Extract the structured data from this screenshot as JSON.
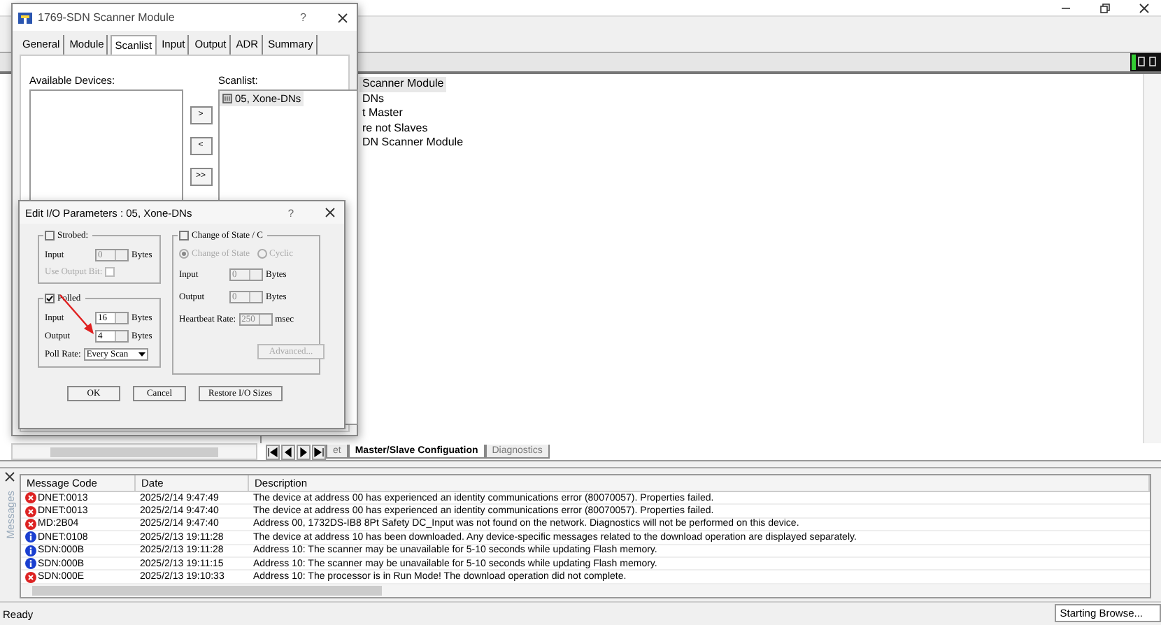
{
  "main_window": {
    "tree_items": [
      {
        "label": "Scanner Module",
        "selected": true
      },
      {
        "label": "DNs",
        "selected": false
      },
      {
        "label": "t Master",
        "selected": false
      },
      {
        "label": "re not Slaves",
        "selected": false
      },
      {
        "label": "DN Scanner Module",
        "selected": false
      }
    ],
    "sheet_tabs": [
      {
        "label": "et",
        "selected": false
      },
      {
        "label": "Master/Slave Configuation",
        "selected": true
      },
      {
        "label": "Diagnostics",
        "selected": false
      }
    ]
  },
  "scanner_dialog": {
    "title": "1769-SDN Scanner Module",
    "help": "?",
    "tabs": [
      {
        "label": "General",
        "selected": false
      },
      {
        "label": "Module",
        "selected": false
      },
      {
        "label": "Scanlist",
        "selected": true
      },
      {
        "label": "Input",
        "selected": false
      },
      {
        "label": "Output",
        "selected": false
      },
      {
        "label": "ADR",
        "selected": false
      },
      {
        "label": "Summary",
        "selected": false
      }
    ],
    "available_label": "Available Devices:",
    "move_buttons": [
      ">",
      "<",
      ">>"
    ],
    "scanlist_label": "Scanlist:",
    "scanlist": [
      {
        "label": "05, Xone-DNs",
        "selected": true
      }
    ]
  },
  "io_dialog": {
    "title": "Edit I/O Parameters : 05, Xone-DNs",
    "help": "?",
    "strobed": {
      "title": "Strobed:",
      "checked": false,
      "fields": [
        {
          "label": "Input",
          "value": "0",
          "unit": "Bytes",
          "disabled": true
        }
      ],
      "use_output_bit": {
        "label": "Use Output Bit:",
        "checked": false
      }
    },
    "polled": {
      "title": "Polled",
      "checked": true,
      "fields": [
        {
          "label": "Input",
          "value": "16",
          "unit": "Bytes",
          "disabled": false
        },
        {
          "label": "Output",
          "value": "4",
          "unit": "Bytes",
          "disabled": false
        }
      ],
      "poll_rate": {
        "label": "Poll Rate:",
        "value": "Every Scan"
      }
    },
    "change_of_state": {
      "title": "Change of State / C",
      "checked": false,
      "modes": [
        {
          "label": "Change of State",
          "selected": true
        },
        {
          "label": "Cyclic",
          "selected": false
        }
      ],
      "fields": [
        {
          "label": "Input",
          "value": "0",
          "unit": "Bytes",
          "disabled": true
        },
        {
          "label": "Output",
          "value": "0",
          "unit": "Bytes",
          "disabled": true
        },
        {
          "label": "Heartbeat Rate:",
          "value": "250",
          "unit": "msec",
          "disabled": true
        }
      ],
      "advanced": "Advanced..."
    },
    "buttons": [
      "OK",
      "Cancel",
      "Restore I/O Sizes"
    ]
  },
  "messages": {
    "panel_label": "Messages",
    "columns": [
      "Message Code",
      "Date",
      "Description"
    ],
    "rows": [
      {
        "kind": "error",
        "code": "DNET:0013",
        "date": "2025/2/14 9:47:49",
        "description": "The device at address 00 has experienced an identity communications error (80070057). Properties failed."
      },
      {
        "kind": "error",
        "code": "DNET:0013",
        "date": "2025/2/14 9:47:40",
        "description": "The device at address 00 has experienced an identity communications error (80070057). Properties failed."
      },
      {
        "kind": "error",
        "code": "MD:2B04",
        "date": "2025/2/14 9:47:40",
        "description": "Address 00, 1732DS-IB8 8Pt Safety DC_Input was not found on the network. Diagnostics will not be performed on this device."
      },
      {
        "kind": "info",
        "code": "DNET:0108",
        "date": "2025/2/13 19:11:28",
        "description": "The device at address 10 has been downloaded.  Any device-specific messages related to the download operation are displayed separately."
      },
      {
        "kind": "info",
        "code": "SDN:000B",
        "date": "2025/2/13 19:11:28",
        "description": "Address 10: The scanner may be unavailable for 5-10 seconds while updating Flash memory."
      },
      {
        "kind": "info",
        "code": "SDN:000B",
        "date": "2025/2/13 19:11:15",
        "description": "Address 10: The scanner may be unavailable for 5-10 seconds while updating Flash memory."
      },
      {
        "kind": "error",
        "code": "SDN:000E",
        "date": "2025/2/13 19:10:33",
        "description": "Address 10: The processor is in Run Mode!  The download operation did not complete."
      }
    ]
  },
  "status_bar": {
    "left": "Ready",
    "right": "Starting Browse..."
  }
}
